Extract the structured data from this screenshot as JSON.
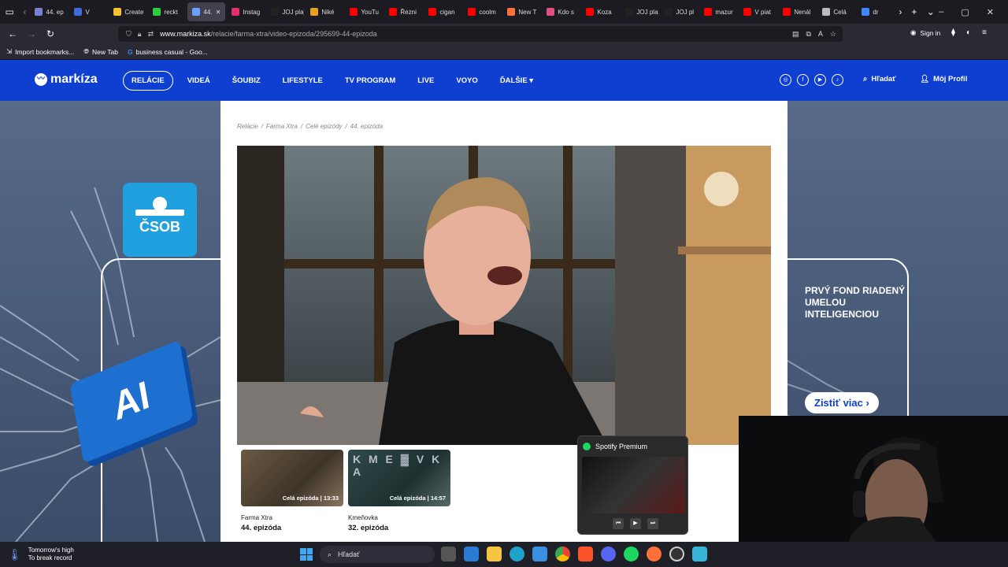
{
  "browser": {
    "tabs": [
      {
        "label": "44. ep",
        "color": "#7a7fd4"
      },
      {
        "label": "V",
        "color": "#3f6bd8"
      },
      {
        "label": "Create",
        "color": "#f2c232"
      },
      {
        "label": "reckt",
        "color": "#2ecc40"
      },
      {
        "label": "44.",
        "color": "#6aa0ff",
        "active": true
      },
      {
        "label": "Instag",
        "color": "#e1306c"
      },
      {
        "label": "JOJ play",
        "color": "#222222"
      },
      {
        "label": "Niké",
        "color": "#e6a020"
      },
      {
        "label": "YouTu",
        "color": "#ff0000"
      },
      {
        "label": "Řezni",
        "color": "#ff0000"
      },
      {
        "label": "cigan",
        "color": "#ff0000"
      },
      {
        "label": "coolm",
        "color": "#ff0000"
      },
      {
        "label": "New T",
        "color": "#ff7139"
      },
      {
        "label": "Kdo s",
        "color": "#e05080"
      },
      {
        "label": "Koza",
        "color": "#ff0000"
      },
      {
        "label": "JOJ play",
        "color": "#222222"
      },
      {
        "label": "JOJ pl",
        "color": "#222222"
      },
      {
        "label": "mazur",
        "color": "#ff0000"
      },
      {
        "label": "V piat",
        "color": "#ff0000"
      },
      {
        "label": "Nenál",
        "color": "#ff0000"
      },
      {
        "label": "Celá",
        "color": "#bbbbbb"
      },
      {
        "label": "dr",
        "color": "#4285f4"
      }
    ],
    "url_host": "www.markiza.sk",
    "url_path": "/relacie/farma-xtra/video-epizoda/295699-44-epizoda",
    "sign_in": "Sign in",
    "bookmarks": [
      "Import bookmarks...",
      "New Tab",
      "business casual - Goo..."
    ]
  },
  "site": {
    "logo": "markíza",
    "menu": [
      "RELÁCIE",
      "VIDEÁ",
      "ŠOUBIZ",
      "LIFESTYLE",
      "TV PROGRAM",
      "LIVE",
      "VOYO",
      "ĎALŠIE ▾"
    ],
    "search_label": "Hľadať",
    "profile_label": "Môj Profil",
    "breadcrumb": [
      "Relácie",
      "Farma Xtra",
      "Celé epizódy",
      "44. epizóda"
    ],
    "thumbnails": [
      {
        "caption": "Celá epizóda | 13:33",
        "show": "Farma Xtra",
        "episode": "44. epizóda"
      },
      {
        "caption": "Celá epizóda | 14:57",
        "show": "Kmeňovka",
        "episode": "32. epizóda"
      }
    ],
    "ad_left_brand": "ČSOB",
    "ad_chip_text": "AI",
    "ad_right_text": "PRVÝ FOND RIADENÝ UMELOU INTELIGENCIOU",
    "ad_right_button": "Zistiť viac  ›"
  },
  "spotify": {
    "title": "Spotify Premium"
  },
  "taskbar": {
    "weather_line1": "Tomorrow's high",
    "weather_line2": "To break record",
    "search_label": "Hľadať"
  }
}
